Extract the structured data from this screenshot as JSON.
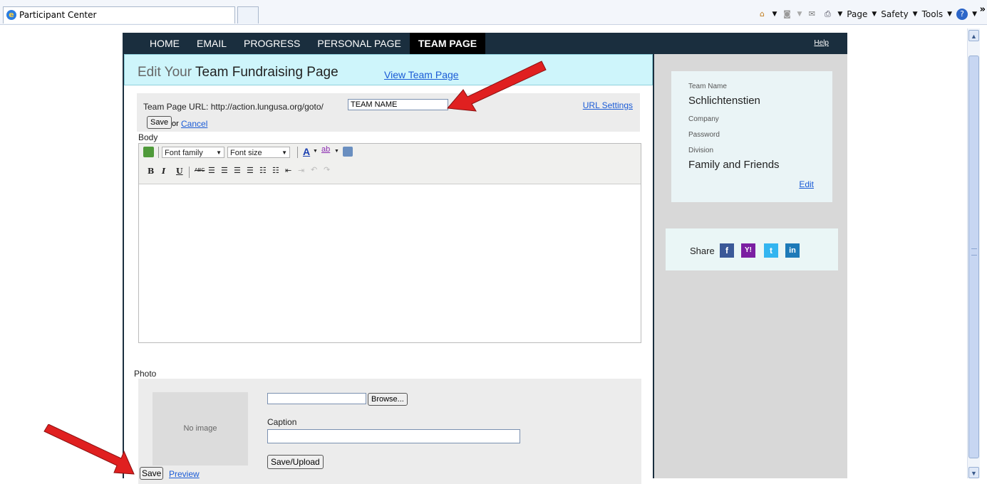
{
  "browser": {
    "tab_title": "Participant Center",
    "commands": [
      "Page",
      "Safety",
      "Tools"
    ],
    "overflow": "»"
  },
  "nav": {
    "items": [
      "HOME",
      "EMAIL",
      "PROGRESS",
      "PERSONAL PAGE",
      "TEAM PAGE"
    ],
    "active_index": 4,
    "help": "Help"
  },
  "title": {
    "prefix": "Edit Your",
    "main": "Team Fundraising Page",
    "view_link": "View Team Page"
  },
  "url": {
    "label": "Team Page URL:  http://action.lungusa.org/goto/",
    "value": "TEAM NAME",
    "settings_link": "URL Settings",
    "save": "Save",
    "or": "or",
    "cancel": "Cancel"
  },
  "editor": {
    "label": "Body",
    "font_family": "Font family",
    "font_size": "Font size",
    "buttons": [
      "B",
      "I",
      "U",
      "ABC"
    ]
  },
  "photo": {
    "label": "Photo",
    "no_image": "No image",
    "browse": "Browse...",
    "caption_label": "Caption",
    "upload": "Save/Upload"
  },
  "footer": {
    "save": "Save",
    "preview": "Preview"
  },
  "team": {
    "name_label": "Team Name",
    "name_value": "Schlichtenstien",
    "company_label": "Company",
    "password_label": "Password",
    "division_label": "Division",
    "division_value": "Family and Friends",
    "edit": "Edit"
  },
  "share": {
    "label": "Share",
    "icons": [
      "facebook-icon",
      "yahoo-icon",
      "twitter-icon",
      "linkedin-icon"
    ]
  },
  "colors": {
    "nav_bg": "#1a2e3e",
    "title_bg": "#cef5fb",
    "link": "#1a5bd6",
    "arrow": "#e02020"
  }
}
